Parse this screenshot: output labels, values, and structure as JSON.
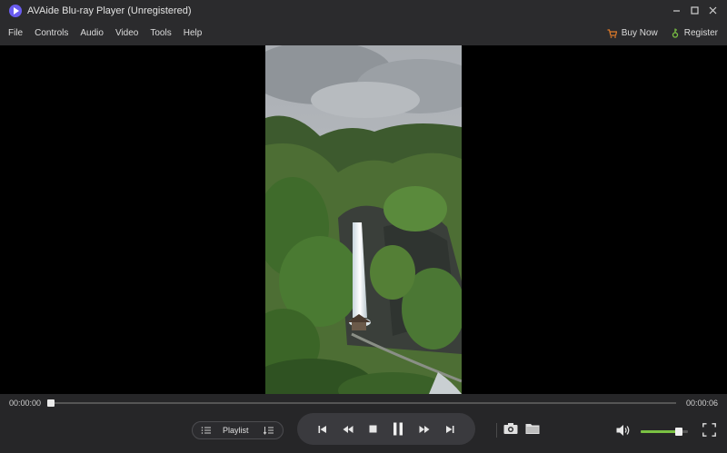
{
  "window": {
    "title": "AVAide Blu-ray Player (Unregistered)"
  },
  "menu": {
    "items": [
      "File",
      "Controls",
      "Audio",
      "Video",
      "Tools",
      "Help"
    ],
    "buy_now": "Buy Now",
    "register": "Register"
  },
  "playback": {
    "current_time": "00:00:00",
    "total_time": "00:00:06",
    "progress": 0.0,
    "volume": 0.8
  },
  "playlist": {
    "label": "Playlist"
  },
  "colors": {
    "accent": "#7ac143",
    "buy_icon": "#e07b2a",
    "logo": "#6a5cf0"
  }
}
